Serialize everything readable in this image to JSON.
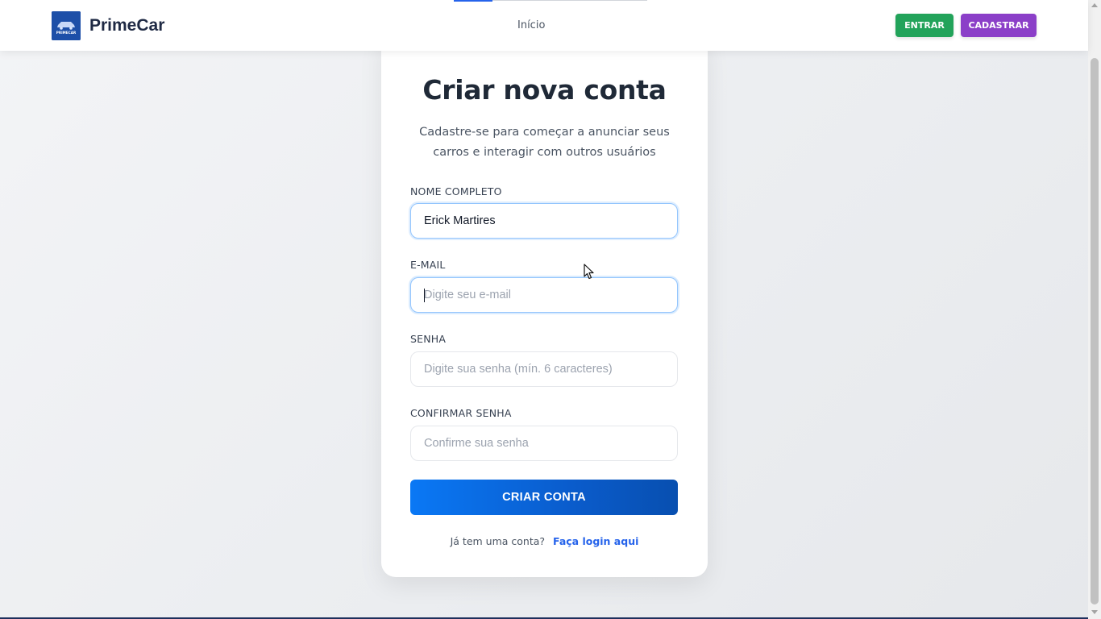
{
  "header": {
    "brand": "PrimeCar",
    "logo_icon": "car-logo-icon",
    "logo_text": "PRIMECAR",
    "nav_links": [
      "Início"
    ],
    "login_button": "ENTRAR",
    "signup_button": "CADASTRAR",
    "colors": {
      "login": "#22a35a",
      "signup": "#8b3fc8",
      "logo_bg": "#1d4fa8"
    }
  },
  "form": {
    "title": "Criar nova conta",
    "subtitle": "Cadastre-se para começar a anunciar seus carros e interagir com outros usuários",
    "fields": [
      {
        "label": "NOME COMPLETO",
        "value": "Erick Martires",
        "placeholder": ""
      },
      {
        "label": "E-MAIL",
        "value": "",
        "placeholder": "Digite seu e-mail"
      },
      {
        "label": "SENHA",
        "value": "",
        "placeholder": "Digite sua senha (mín. 6 caracteres)"
      },
      {
        "label": "CONFIRMAR SENHA",
        "value": "",
        "placeholder": "Confirme sua senha"
      }
    ],
    "submit": "CRIAR CONTA",
    "login_prompt": "Já tem uma conta?",
    "login_link": "Faça login aqui",
    "accent_color": "#0a66e0"
  }
}
